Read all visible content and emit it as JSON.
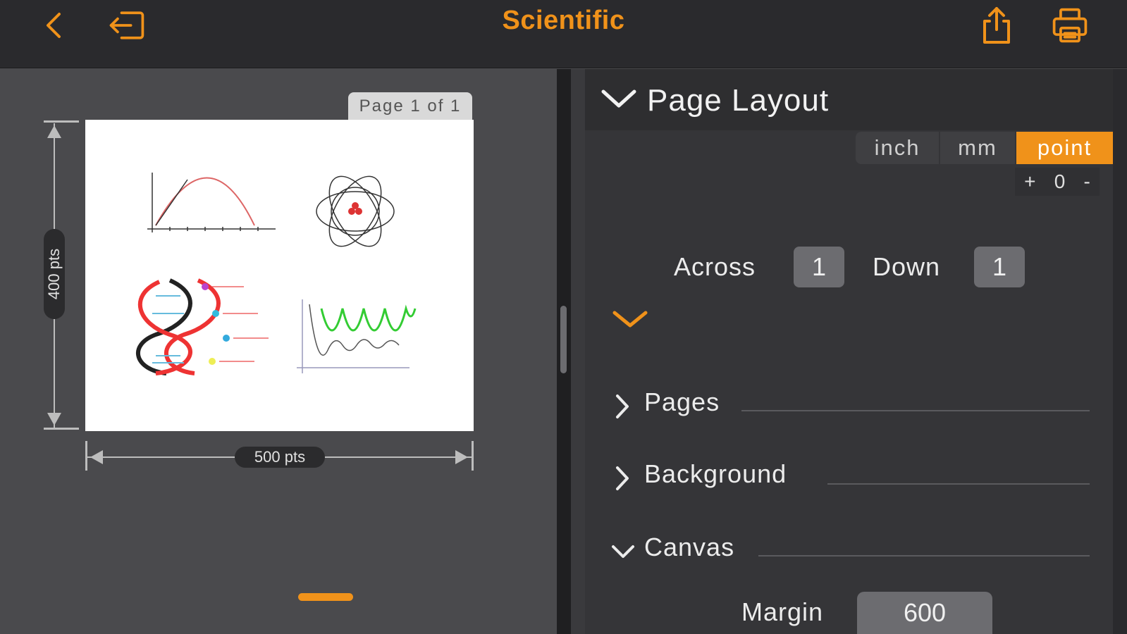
{
  "header": {
    "title": "Scientific",
    "back_icon": "chevron-left-icon",
    "exit_icon": "sign-out-icon",
    "share_icon": "share-icon",
    "print_icon": "printer-icon"
  },
  "preview": {
    "page_tab": "Page 1 of 1",
    "height_label": "400 pts",
    "width_label": "500 pts"
  },
  "panel": {
    "section_title": "Page Layout",
    "units": [
      "inch",
      "mm",
      "point"
    ],
    "selected_unit": "point",
    "stepper": {
      "plus": "+",
      "value": "0",
      "minus": "-"
    },
    "across_label": "Across",
    "across_value": "1",
    "down_label": "Down",
    "down_value": "1",
    "sections": [
      "Pages",
      "Background",
      "Canvas"
    ],
    "margin_label": "Margin",
    "margin_value": "600"
  },
  "colors": {
    "accent": "#f0921a",
    "topbar": "#2a2a2d",
    "panel": "#353538",
    "preview_bg": "#4a4a4d"
  }
}
